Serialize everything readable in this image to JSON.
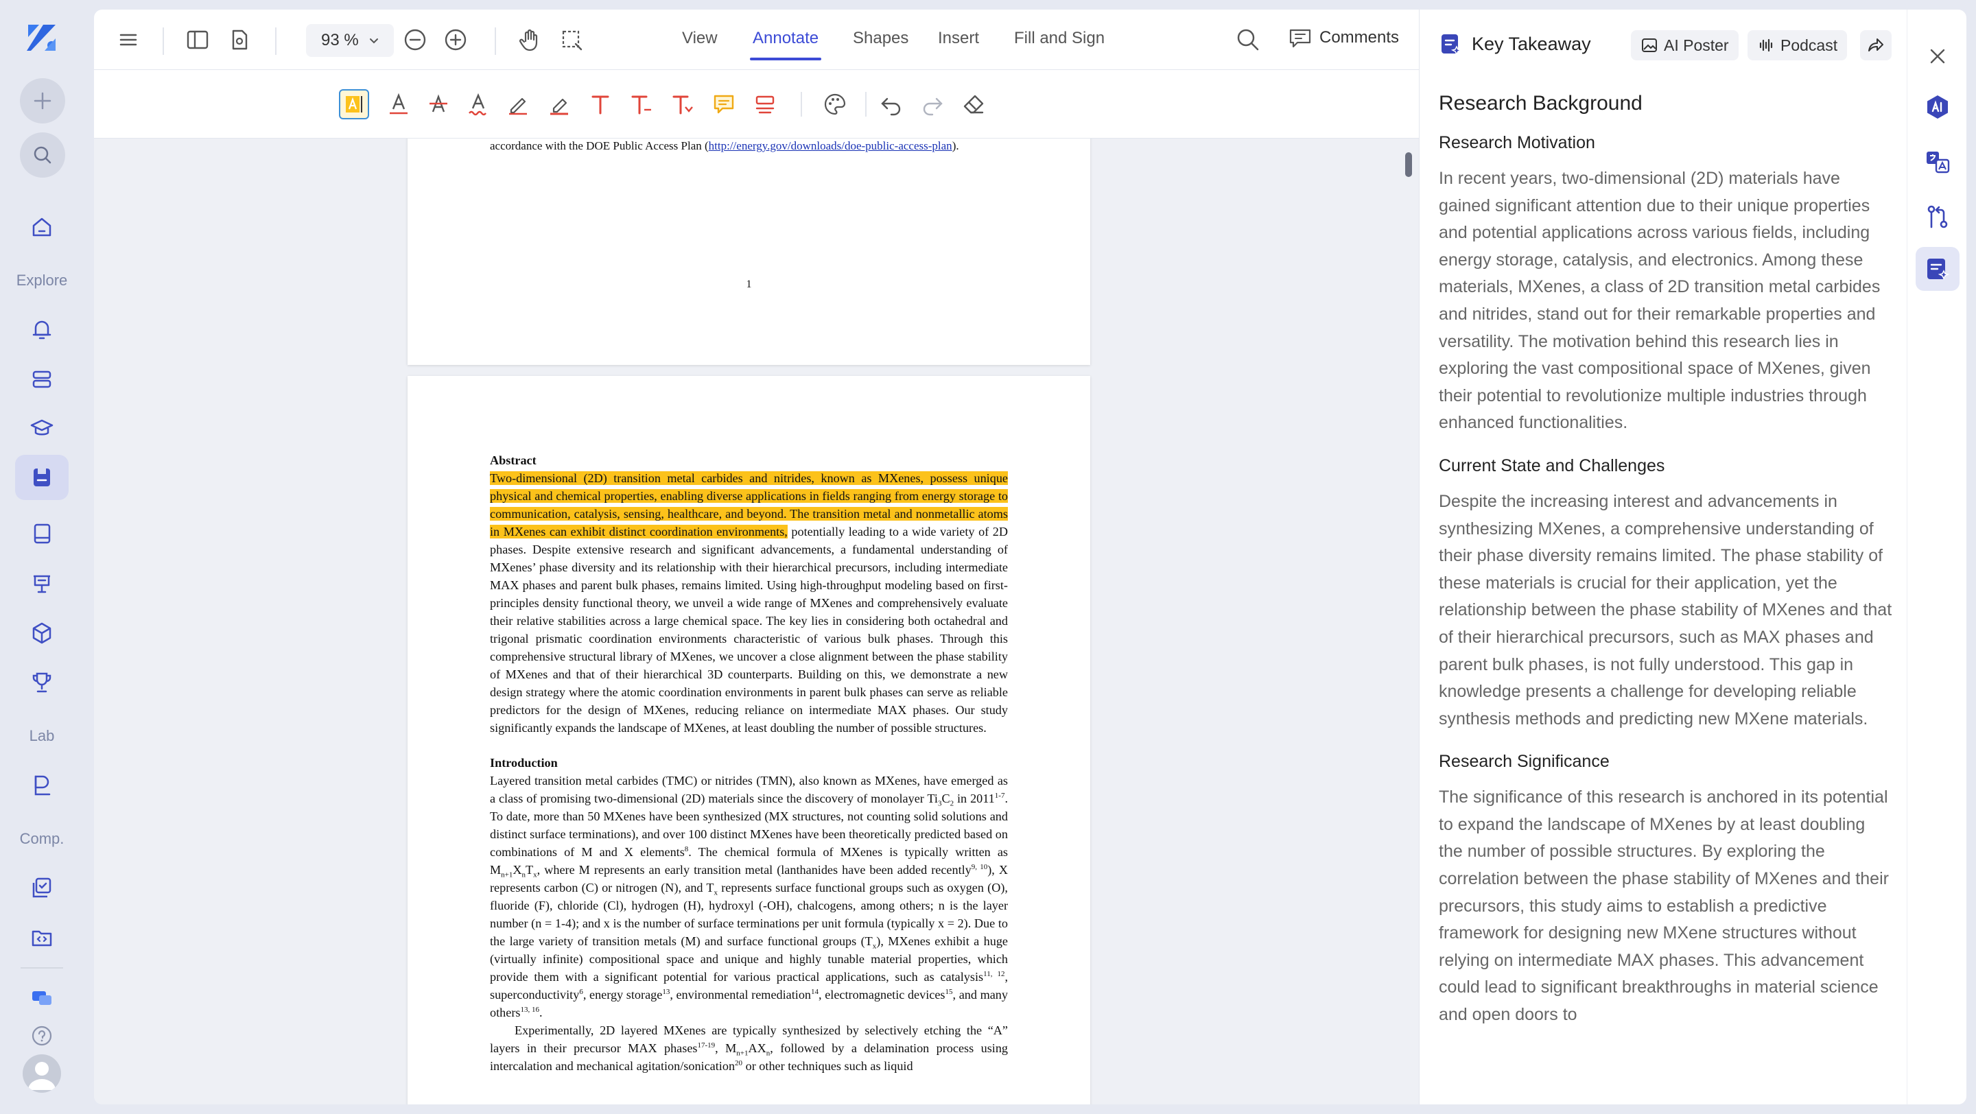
{
  "sidebar": {
    "labels": {
      "explore": "Explore",
      "lab": "Lab",
      "comp": "Comp."
    }
  },
  "toolbar": {
    "zoom": "93 %",
    "tabs": [
      "View",
      "Annotate",
      "Shapes",
      "Insert",
      "Fill and Sign"
    ],
    "active_tab": "Annotate",
    "comments_label": "Comments"
  },
  "document": {
    "page1": {
      "line_prefix": "accordance with the DOE Public Access Plan (",
      "link": "http://energy.gov/downloads/doe-public-access-plan",
      "line_suffix": ").",
      "page_number": "1"
    },
    "abstract": {
      "heading": "Abstract",
      "highlighted": "Two-dimensional (2D) transition metal carbides and nitrides, known as MXenes, possess unique physical and chemical properties, enabling diverse applications in fields ranging from energy storage to communication, catalysis, sensing, healthcare, and beyond. The transition metal and nonmetallic atoms in MXenes can exhibit distinct coordination environments,",
      "rest": " potentially leading to a wide variety of 2D phases. Despite extensive research and significant advancements, a fundamental understanding of MXenes’ phase diversity and its relationship with their hierarchical precursors, including intermediate MAX phases and parent bulk phases, remains limited. Using high-throughput modeling based on first-principles density functional theory, we unveil a wide range of MXenes and comprehensively evaluate their relative stabilities across a large chemical space. The key lies in considering both octahedral and trigonal prismatic coordination environments characteristic of various bulk phases. Through this comprehensive structural library of MXenes, we uncover a close alignment between the phase stability of MXenes and that of their hierarchical 3D counterparts. Building on this, we demonstrate a new design strategy where the atomic coordination environments in parent bulk phases can serve as reliable predictors for the design of MXenes, reducing reliance on intermediate MAX phases. Our study significantly expands the landscape of MXenes, at least doubling the number of possible structures."
    },
    "introduction": {
      "heading": "Introduction",
      "p1_a": "Layered transition metal carbides (TMC) or nitrides (TMN), also known as MXenes, have emerged as a class of promising two-dimensional (2D) materials since the discovery of monolayer Ti",
      "p1_b": "3",
      "p1_c": "C",
      "p1_d": "2",
      "p1_e": " in 2011",
      "p1_f": "1-7",
      "p1_g": ". To date, more than 50 MXenes have been synthesized (MX structures, not counting solid solutions and distinct surface terminations), and over 100 distinct MXenes have been theoretically predicted based on combinations of M and X elements",
      "p1_h": "8",
      "p1_i": ". The chemical formula of MXenes is typically written as M",
      "p1_j": "n+1",
      "p1_k": "X",
      "p1_l": "n",
      "p1_m": "T",
      "p1_n": "x",
      "p1_o": ", where M represents an early transition metal (lanthanides have been added recently",
      "p1_p": "9, 10",
      "p1_q": "), X represents carbon (C) or nitrogen (N), and T",
      "p1_r": "x",
      "p1_s": " represents surface functional groups such as oxygen (O), fluoride (F), chloride (Cl), hydrogen (H), hydroxyl (-OH), chalcogens, among others; n is the layer number (n = 1-4); and x is the number of surface terminations per unit formula (typically x = 2). Due to the large variety of transition metals (M) and surface functional groups (T",
      "p1_t": "x",
      "p1_u": "), MXenes exhibit a huge (virtually infinite) compositional space and unique and highly tunable material properties, which provide them with a significant potential for various practical applications, such as catalysis",
      "p1_v": "11, 12",
      "p1_w": ", superconductivity",
      "p1_x": "6",
      "p1_y": ", energy storage",
      "p1_z": "13",
      "p1_aa": ", environmental remediation",
      "p1_ab": "14",
      "p1_ac": ", electromagnetic devices",
      "p1_ad": "15",
      "p1_ae": ", and many others",
      "p1_af": "13, 16",
      "p1_ag": ".",
      "p2_a": "Experimentally, 2D layered MXenes are typically synthesized by selectively etching the “A” layers in their precursor MAX phases",
      "p2_b": "17-19",
      "p2_c": ", M",
      "p2_d": "n+1",
      "p2_e": "AX",
      "p2_f": "n",
      "p2_g": ", followed by a delamination process using intercalation and mechanical agitation/sonication",
      "p2_h": "20",
      "p2_i": " or other techniques such as liquid"
    }
  },
  "panel": {
    "title": "Key Takeaway",
    "ai_poster": "AI Poster",
    "podcast": "Podcast",
    "section_title": "Research Background",
    "sections": [
      {
        "heading": "Research Motivation",
        "body": "In recent years, two-dimensional (2D) materials have gained significant attention due to their unique properties and potential applications across various fields, including energy storage, catalysis, and electronics. Among these materials, MXenes, a class of 2D transition metal carbides and nitrides, stand out for their remarkable properties and versatility. The motivation behind this research lies in exploring the vast compositional space of MXenes, given their potential to revolutionize multiple industries through enhanced functionalities."
      },
      {
        "heading": "Current State and Challenges",
        "body": "Despite the increasing interest and advancements in synthesizing MXenes, a comprehensive understanding of their phase diversity remains limited. The phase stability of these materials is crucial for their application, yet the relationship between the phase stability of MXenes and that of their hierarchical precursors, such as MAX phases and parent bulk phases, is not fully understood. This gap in knowledge presents a challenge for developing reliable synthesis methods and predicting new MXene materials."
      },
      {
        "heading": "Research Significance",
        "body": "The significance of this research is anchored in its potential to expand the landscape of MXenes by at least doubling the number of possible structures. By exploring the correlation between the phase stability of MXenes and their precursors, this study aims to establish a predictive framework for designing new MXene structures without relying on intermediate MAX phases. This advancement could lead to significant breakthroughs in material science and open doors to"
      }
    ]
  },
  "colors": {
    "accent": "#3c4bd6",
    "highlight": "#fcc21b",
    "annotation_red": "#e0453a"
  }
}
